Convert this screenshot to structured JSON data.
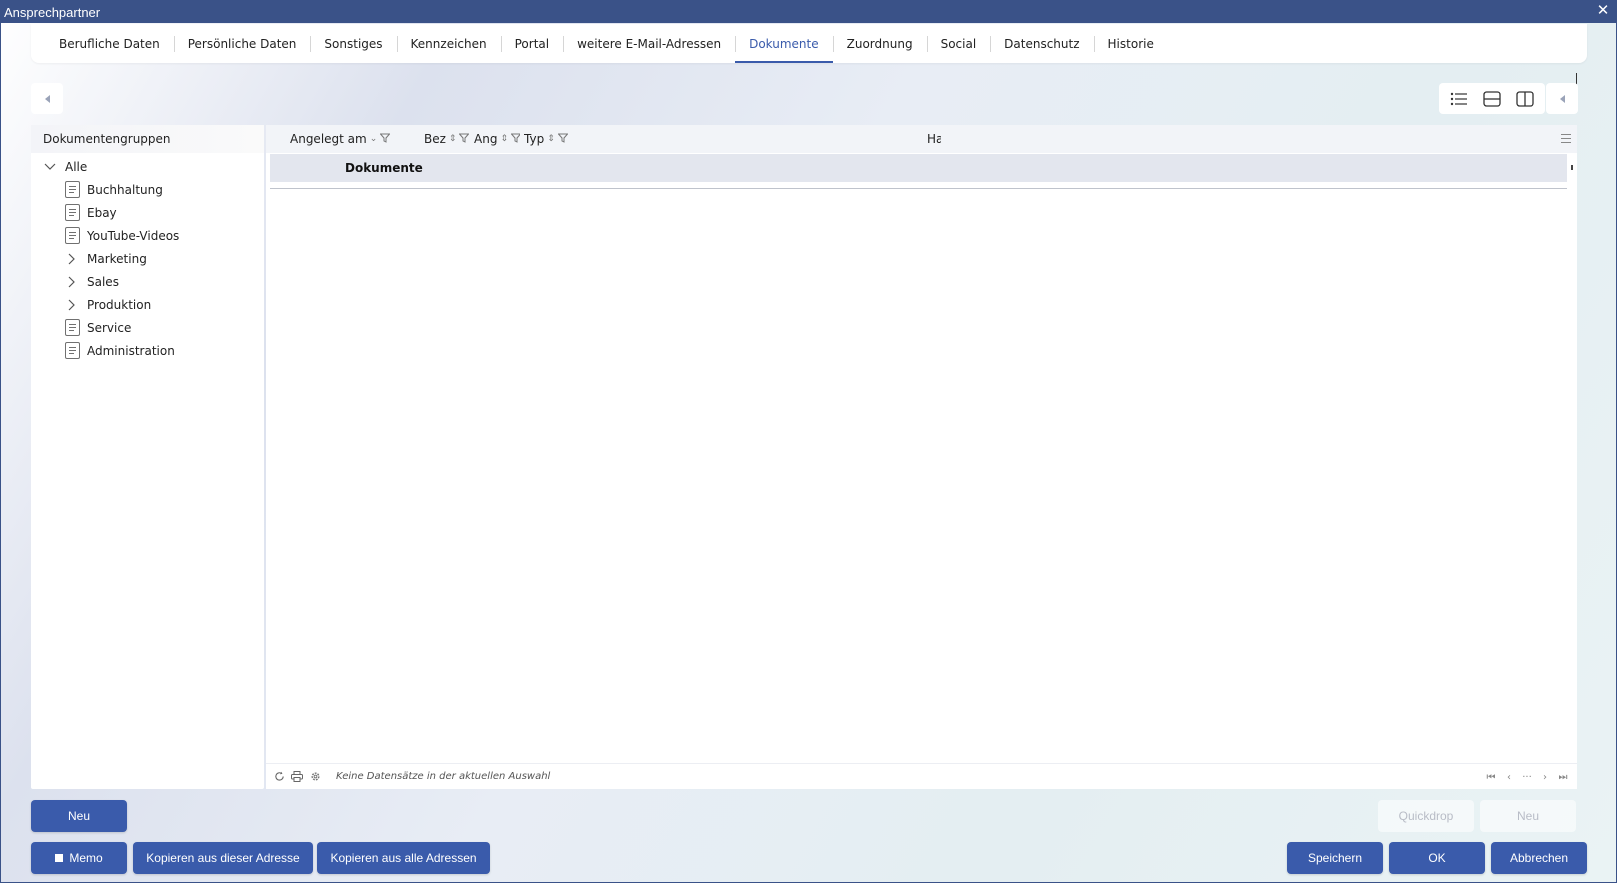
{
  "window": {
    "title": "Ansprechpartner"
  },
  "tabs": [
    {
      "label": "Berufliche Daten",
      "active": false
    },
    {
      "label": "Persönliche Daten",
      "active": false
    },
    {
      "label": "Sonstiges",
      "active": false
    },
    {
      "label": "Kennzeichen",
      "active": false
    },
    {
      "label": "Portal",
      "active": false
    },
    {
      "label": "weitere E-Mail-Adressen",
      "active": false
    },
    {
      "label": "Dokumente",
      "active": true
    },
    {
      "label": "Zuordnung",
      "active": false
    },
    {
      "label": "Social",
      "active": false
    },
    {
      "label": "Datenschutz",
      "active": false
    },
    {
      "label": "Historie",
      "active": false
    }
  ],
  "left_panel": {
    "title": "Dokumentengruppen",
    "tree": [
      {
        "label": "Alle",
        "level": 0,
        "kind": "expanded"
      },
      {
        "label": "Buchhaltung",
        "level": 1,
        "kind": "doc"
      },
      {
        "label": "Ebay",
        "level": 1,
        "kind": "doc"
      },
      {
        "label": "YouTube-Videos",
        "level": 1,
        "kind": "doc"
      },
      {
        "label": "Marketing",
        "level": 1,
        "kind": "collapsed"
      },
      {
        "label": "Sales",
        "level": 1,
        "kind": "collapsed"
      },
      {
        "label": "Produktion",
        "level": 1,
        "kind": "collapsed"
      },
      {
        "label": "Service",
        "level": 1,
        "kind": "doc"
      },
      {
        "label": "Administration",
        "level": 1,
        "kind": "doc"
      }
    ]
  },
  "grid": {
    "columns": {
      "angelegt_am": "Angelegt am",
      "bez": "Bez",
      "ang": "Ang",
      "typ": "Typ",
      "ha": "Ha"
    },
    "group_label": "Dokumente",
    "status_message": "Keine Datensätze in der aktuellen Auswahl"
  },
  "buttons": {
    "neu_left": "Neu",
    "memo": "Memo",
    "kopieren_dieser": "Kopieren aus dieser Adresse",
    "kopieren_alle": "Kopieren aus alle Adressen",
    "quickdrop": "Quickdrop",
    "neu_right": "Neu",
    "speichern": "Speichern",
    "ok": "OK",
    "abbrechen": "Abbrechen"
  },
  "colors": {
    "accent": "#3a5bab",
    "titlebar": "#3a5288"
  }
}
